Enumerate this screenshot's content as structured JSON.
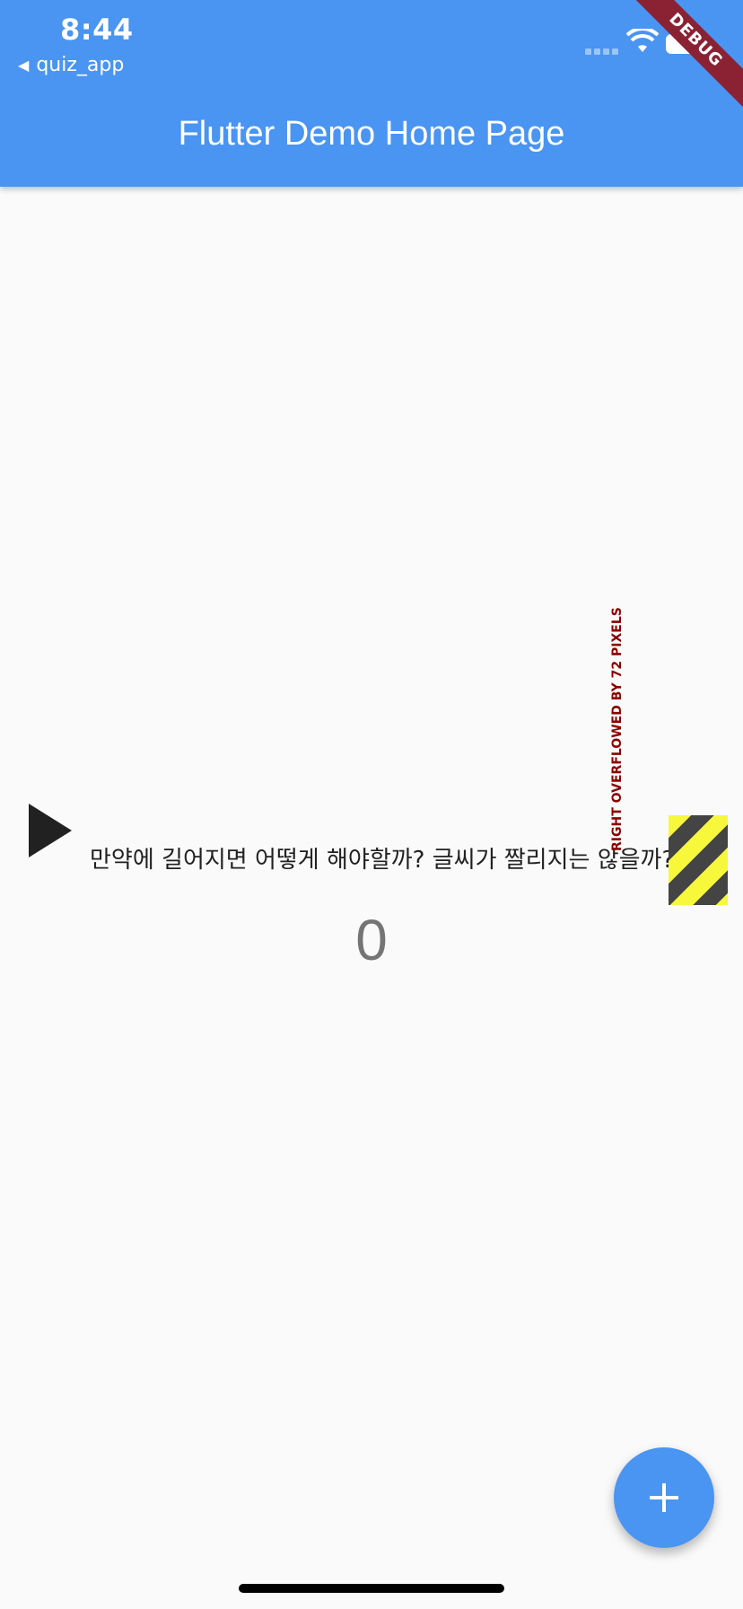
{
  "status_bar": {
    "time": "8:44",
    "back_app": "quiz_app"
  },
  "app_bar": {
    "title": "Flutter Demo Home Page",
    "background": "#4a94f2"
  },
  "debug_banner": "DEBUG",
  "question": {
    "icon": "play-arrow-icon",
    "text": "만약에 길어지면 어떻게 해야할까? 글씨가 짤리지는 않을까??? 응?"
  },
  "counter_value": "0",
  "overflow_warning": "RIGHT OVERFLOWED BY 72 PIXELS",
  "fab": {
    "icon": "plus-icon"
  }
}
